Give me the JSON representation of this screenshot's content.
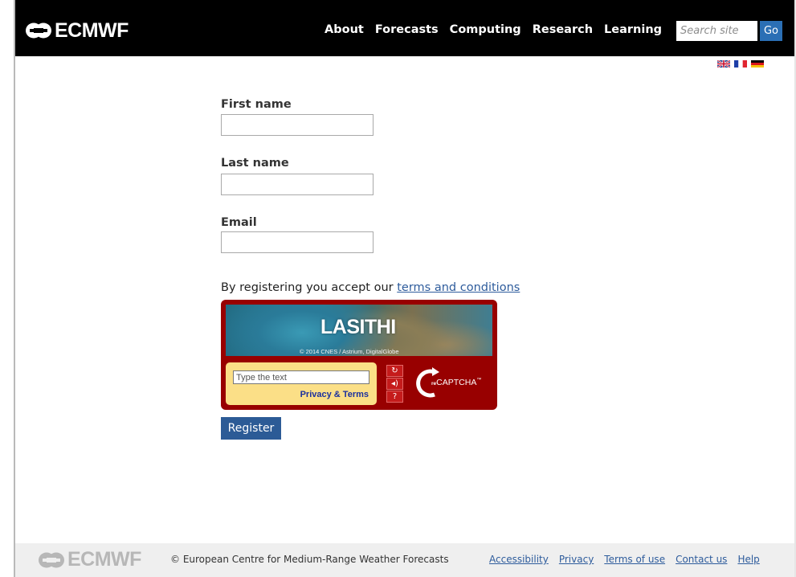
{
  "header": {
    "logo_text": "ECMWF",
    "nav": [
      {
        "label": "About"
      },
      {
        "label": "Forecasts"
      },
      {
        "label": "Computing"
      },
      {
        "label": "Research"
      },
      {
        "label": "Learning"
      }
    ],
    "search": {
      "placeholder": "Search site",
      "button_label": "Go"
    }
  },
  "languages": [
    "English",
    "Français",
    "Deutsch"
  ],
  "form": {
    "first_name": {
      "label": "First name",
      "value": ""
    },
    "last_name": {
      "label": "Last name",
      "value": ""
    },
    "email": {
      "label": "Email",
      "value": ""
    },
    "terms_prefix": "By registering you accept our ",
    "terms_link": "terms and conditions",
    "register_label": "Register"
  },
  "captcha": {
    "challenge_word": "LASITHI",
    "image_credit": "© 2014 CNES / Astrium, DigitalGlobe",
    "input_placeholder": "Type the text",
    "privacy_terms": "Privacy & Terms",
    "brand_prefix": "re",
    "brand": "CAPTCHA",
    "brand_tm": "™"
  },
  "footer": {
    "logo_text": "ECMWF",
    "copyright": "© European Centre for Medium-Range Weather Forecasts",
    "links": [
      {
        "label": "Accessibility"
      },
      {
        "label": "Privacy"
      },
      {
        "label": "Terms of use"
      },
      {
        "label": "Contact us"
      },
      {
        "label": "Help"
      }
    ]
  },
  "colors": {
    "header_bg": "#000000",
    "accent": "#2b6fb5",
    "captcha_red": "#980000",
    "captcha_panel": "#fbdf87",
    "link": "#2e5c9c"
  }
}
